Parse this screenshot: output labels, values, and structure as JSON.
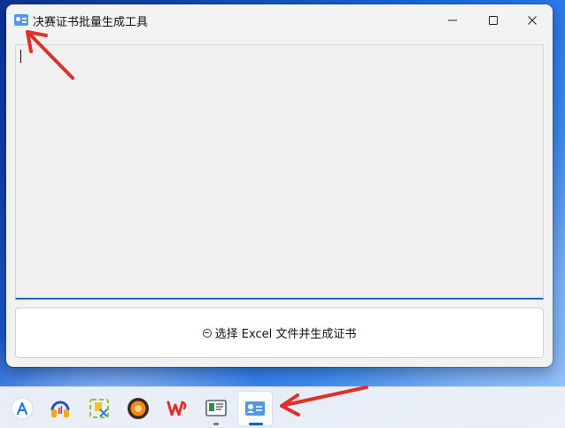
{
  "window": {
    "title": "决赛证书批量生成工具",
    "app_icon": "certificate-card-icon",
    "controls": {
      "minimize_icon": "minimize-icon",
      "maximize_icon": "maximize-icon",
      "close_icon": "close-icon"
    }
  },
  "log_area": {
    "value": ""
  },
  "action_button": {
    "icon": "app-glyph-icon",
    "label": "选择 Excel 文件并生成证书"
  },
  "taskbar": {
    "apps": [
      {
        "icon": "app-store-icon"
      },
      {
        "icon": "audio-headphones-icon"
      },
      {
        "icon": "image-tools-icon"
      },
      {
        "icon": "orange-circle-app-icon"
      },
      {
        "icon": "wps-office-icon"
      },
      {
        "icon": "screen-app-icon",
        "running": true
      },
      {
        "icon": "certificate-card-icon",
        "running": true,
        "active": true
      }
    ]
  },
  "colors": {
    "accent": "#0d66c2",
    "annotation_arrow": "#e0302b",
    "window_bg": "#f2f2f2"
  }
}
